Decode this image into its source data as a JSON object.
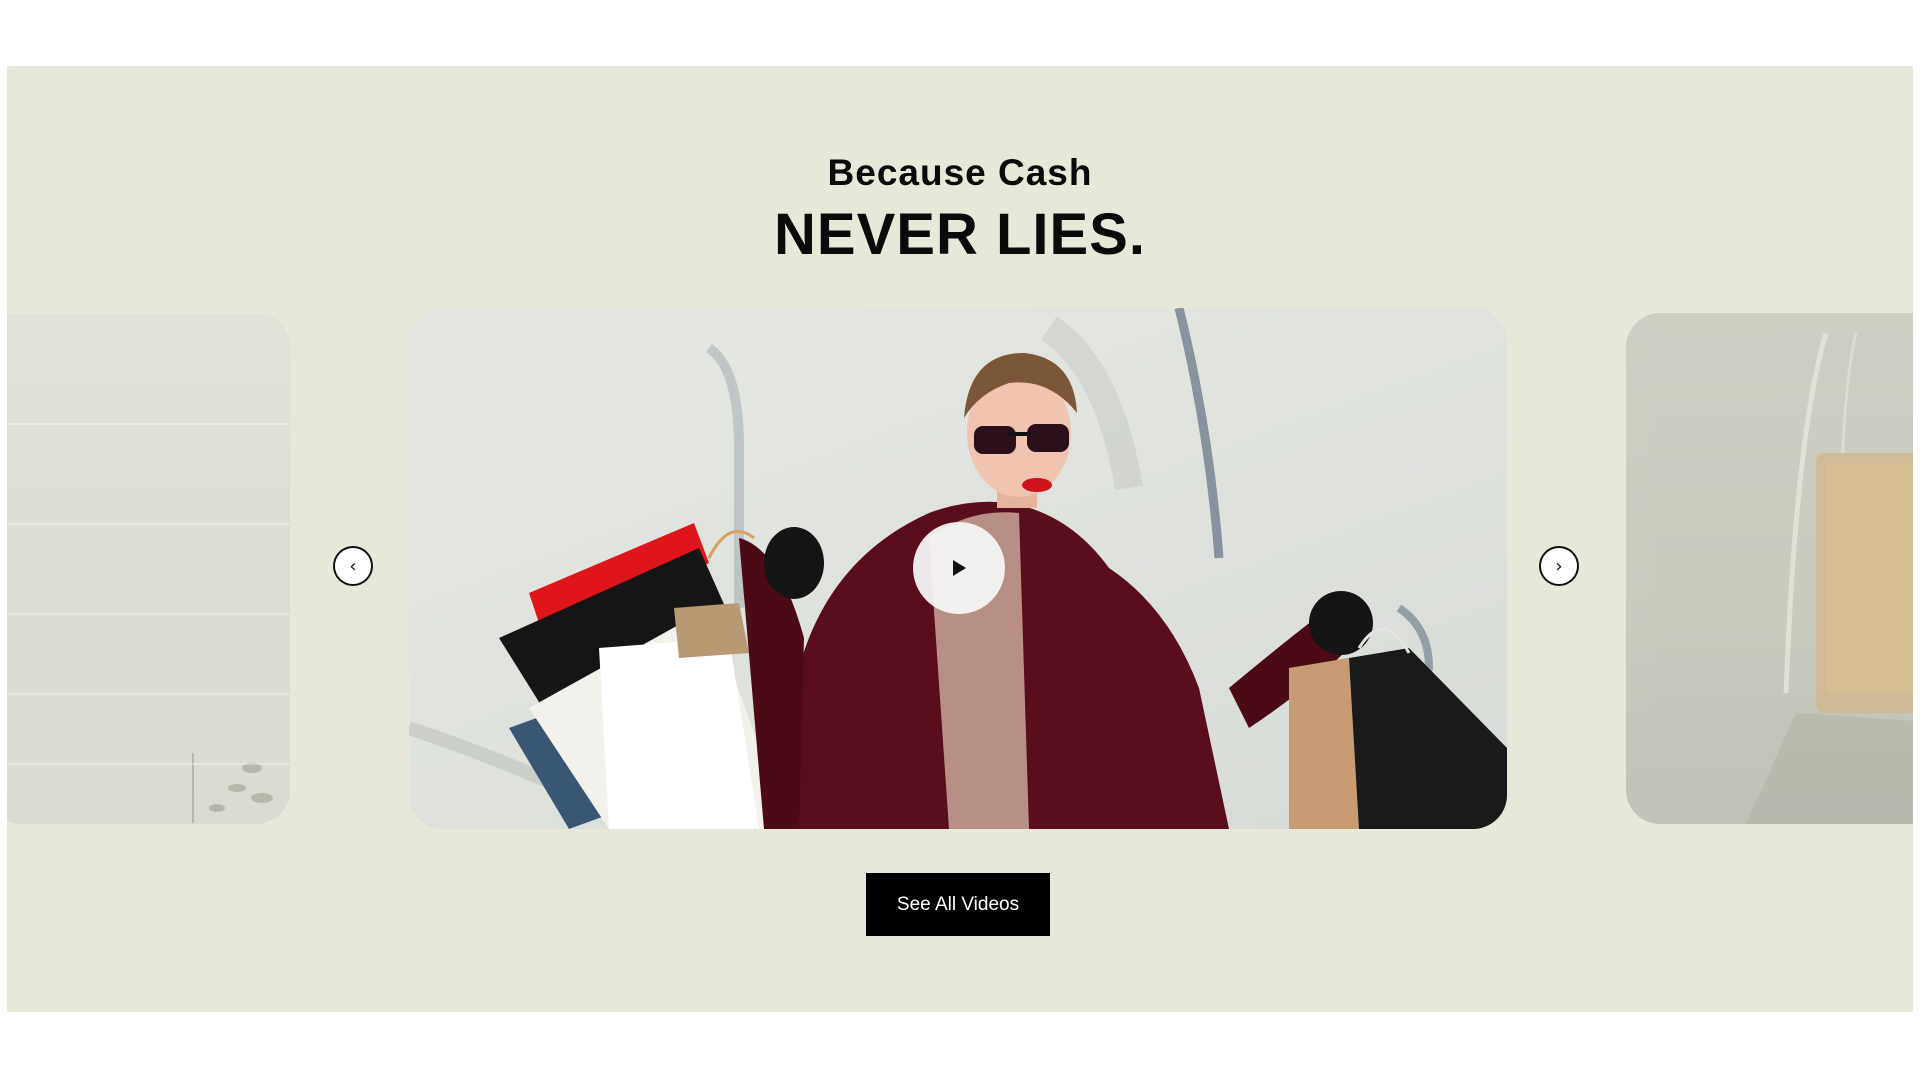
{
  "heading": {
    "kicker": "Because Cash",
    "title": "NEVER LIES."
  },
  "carousel": {
    "prev_icon": "chevron-left-icon",
    "next_icon": "chevron-right-icon",
    "prev_glyph": "‹",
    "next_glyph": "›",
    "play_icon": "play-icon"
  },
  "cta": {
    "label": "See All Videos"
  },
  "colors": {
    "section_bg": "#e8e8da",
    "button_bg": "#000000",
    "button_text": "#ffffff"
  }
}
